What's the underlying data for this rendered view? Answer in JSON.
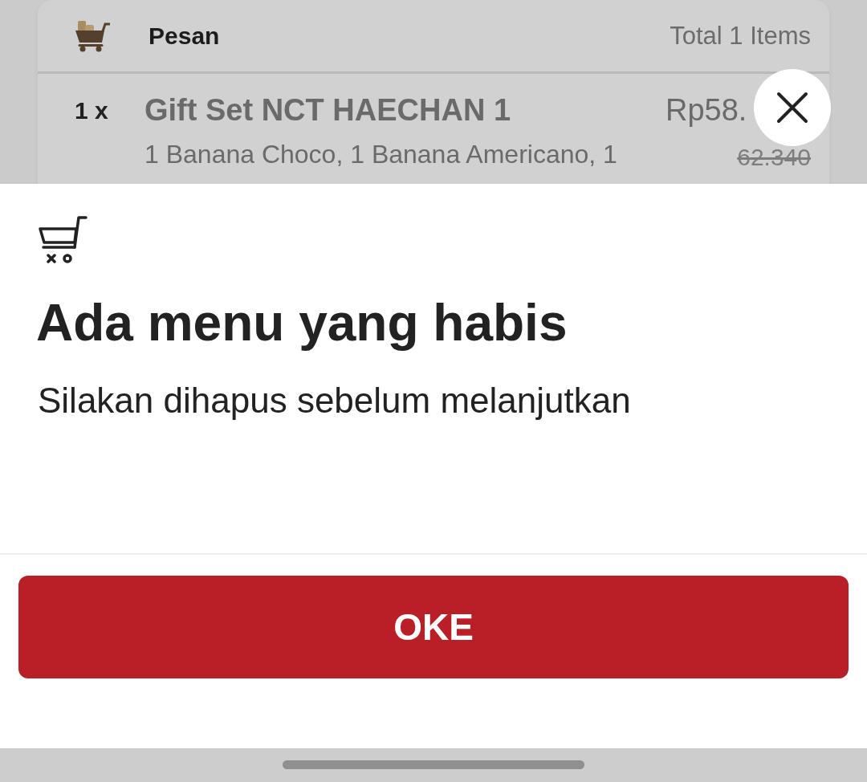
{
  "order_card": {
    "title": "Pesan",
    "total": "Total 1 Items",
    "items": [
      {
        "quantity": "1 x",
        "name": "Gift Set NCT HAECHAN 1",
        "price": "Rp58.",
        "original_price": "62.340",
        "description": "1 Banana Choco, 1 Banana Americano, 1"
      }
    ]
  },
  "dialog": {
    "title": "Ada menu yang habis",
    "message": "Silakan dihapus sebelum melanjutkan",
    "button": "OKE"
  }
}
